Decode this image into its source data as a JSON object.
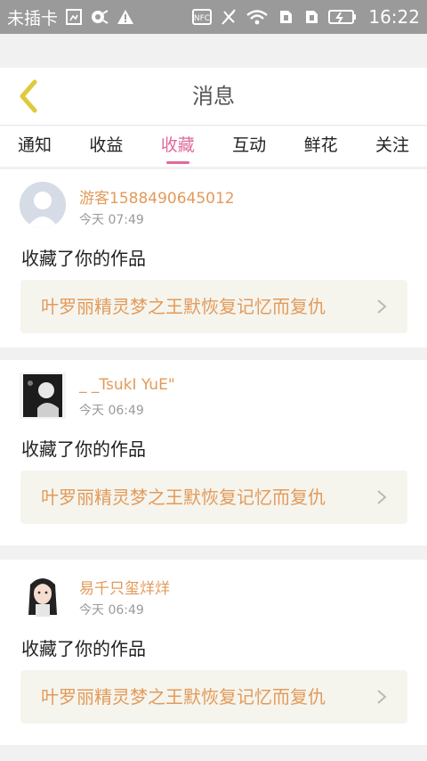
{
  "status_bar": {
    "carrier": "未插卡",
    "time": "16:22",
    "icons": [
      "sim-icon",
      "record-icon",
      "warning-icon",
      "nfc-icon",
      "mute-icon",
      "wifi-icon",
      "sim-slot-1-icon",
      "sim-slot-2-icon",
      "battery-icon"
    ]
  },
  "header": {
    "title": "消息",
    "back_icon": "chevron-left-icon",
    "accent_color": "#e0c93a"
  },
  "tabs": [
    {
      "label": "通知",
      "active": false
    },
    {
      "label": "收益",
      "active": false
    },
    {
      "label": "收藏",
      "active": true
    },
    {
      "label": "互动",
      "active": false
    },
    {
      "label": "鲜花",
      "active": false
    },
    {
      "label": "关注",
      "active": false
    }
  ],
  "colors": {
    "tab_active": "#e06a9b",
    "name": "#e39a5a",
    "work_title": "#e39a5a",
    "work_bg": "#f5f5ee"
  },
  "messages": [
    {
      "user_name": "游客1588490645012",
      "time": "今天 07:49",
      "action": "收藏了你的作品",
      "work_title": "叶罗丽精灵梦之王默恢复记忆而复仇",
      "avatar": "default-avatar-icon"
    },
    {
      "user_name": "_ _TsukI YuE\"",
      "time": "今天 06:49",
      "action": "收藏了你的作品",
      "work_title": "叶罗丽精灵梦之王默恢复记忆而复仇",
      "avatar": "dark-portrait-avatar"
    },
    {
      "user_name": "易千只玺烊烊",
      "time": "今天 06:49",
      "action": "收藏了你的作品",
      "work_title": "叶罗丽精灵梦之王默恢复记忆而复仇",
      "avatar": "anime-girl-avatar"
    }
  ]
}
